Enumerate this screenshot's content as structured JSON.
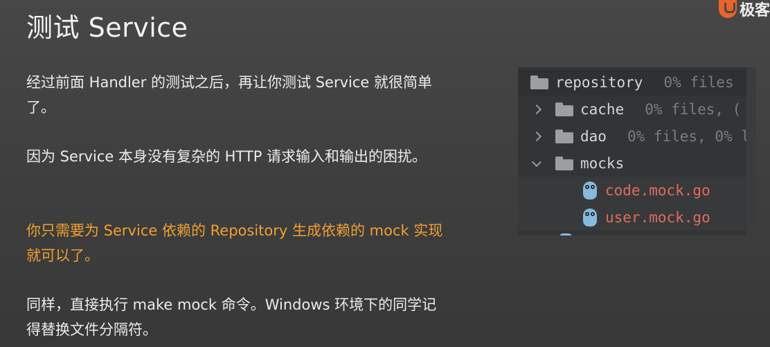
{
  "slide": {
    "title": "测试 Service",
    "logo_text": "极客"
  },
  "paragraphs": [
    "经过前面 Handler 的测试之后，再让你测试 Service 就很简单了。",
    "因为 Service 本身没有复杂的 HTTP 请求输入和输出的困扰。",
    "你只需要为 Service 依赖的 Repository 生成依赖的 mock 实现就可以了。",
    "同样，直接执行 make mock 命令。Windows 环境下的同学记得替换文件分隔符。"
  ],
  "file_tree": {
    "rows": [
      {
        "name": "repository",
        "meta": "0% files",
        "type": "folder",
        "chevron": "none"
      },
      {
        "name": "cache",
        "meta": "0% files, (",
        "type": "folder",
        "chevron": "right"
      },
      {
        "name": "dao",
        "meta": "0% files, 0% l",
        "type": "folder",
        "chevron": "right"
      },
      {
        "name": "mocks",
        "meta": "",
        "type": "folder",
        "chevron": "down"
      },
      {
        "name": "code.mock.go",
        "meta": "",
        "type": "go-file",
        "chevron": "none"
      },
      {
        "name": "user.mock.go",
        "meta": "",
        "type": "go-file",
        "chevron": "none"
      }
    ]
  },
  "colors": {
    "highlight_text": "#f0a030",
    "go_file_text": "#e06c5a",
    "logo_accent": "#e8642b"
  },
  "icons": [
    "folder-icon",
    "chevron-right-icon",
    "chevron-down-icon",
    "gopher-icon",
    "logo-icon"
  ]
}
